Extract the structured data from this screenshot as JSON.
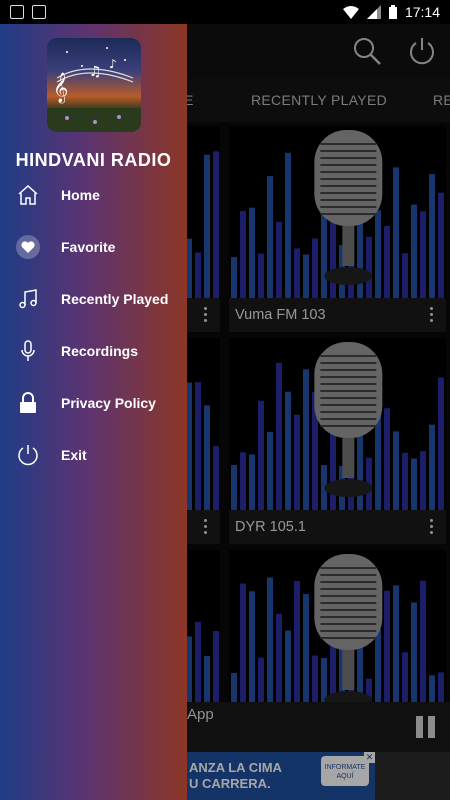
{
  "status_bar": {
    "time": "17:14"
  },
  "app_bar": {
    "icons": [
      "search-icon",
      "power-icon"
    ]
  },
  "tabs": [
    "E",
    "RECENTLY PLAYED",
    "RE"
  ],
  "stations": [
    {
      "name": ""
    },
    {
      "name": "Vuma FM 103"
    },
    {
      "name": ""
    },
    {
      "name": "DYR 105.1"
    },
    {
      "name": ""
    },
    {
      "name": ""
    }
  ],
  "player": {
    "title": "App"
  },
  "ad": {
    "line1": "ANZA LA CIMA",
    "line2": "U CARRERA.",
    "button_line1": "INFORMATE",
    "button_line2": "AQUÍ"
  },
  "drawer": {
    "app_name": "HINDVANI RADIO",
    "menu": [
      {
        "label": "Home",
        "icon": "home-icon"
      },
      {
        "label": "Favorite",
        "icon": "heart-icon"
      },
      {
        "label": "Recently Played",
        "icon": "music-note-icon"
      },
      {
        "label": "Recordings",
        "icon": "microphone-icon"
      },
      {
        "label": "Privacy Policy",
        "icon": "lock-icon"
      },
      {
        "label": "Exit",
        "icon": "power-icon"
      }
    ]
  },
  "colors": {
    "drawer_left": "#1f3c86",
    "drawer_right": "#8c3626",
    "ad_blue": "#1f4f9e"
  }
}
